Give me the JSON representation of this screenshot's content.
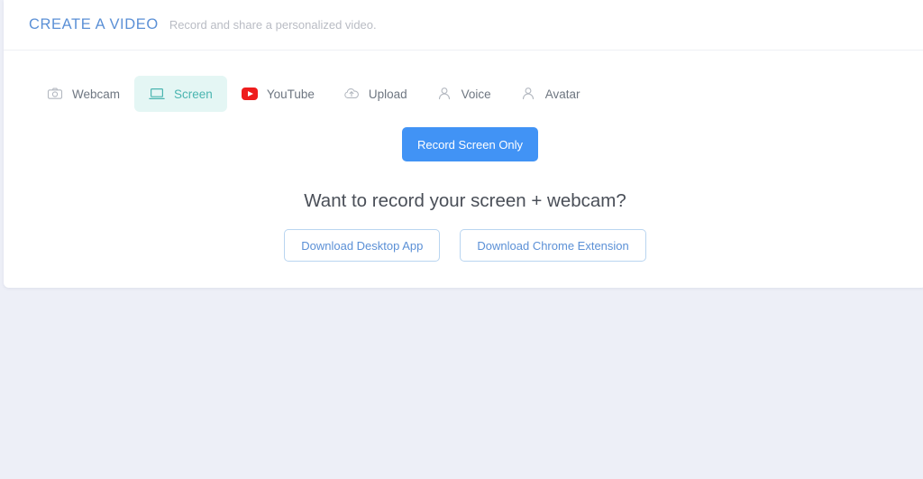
{
  "header": {
    "title": "CREATE A VIDEO",
    "subtitle": "Record and share a personalized video."
  },
  "tabs": [
    {
      "label": "Webcam",
      "icon": "camera-icon",
      "active": false
    },
    {
      "label": "Screen",
      "icon": "laptop-screen-icon",
      "active": true
    },
    {
      "label": "YouTube",
      "icon": "youtube-icon",
      "active": false
    },
    {
      "label": "Upload",
      "icon": "cloud-upload-icon",
      "active": false
    },
    {
      "label": "Voice",
      "icon": "person-icon",
      "active": false
    },
    {
      "label": "Avatar",
      "icon": "person-icon",
      "active": false
    }
  ],
  "main": {
    "record_button_label": "Record Screen Only",
    "prompt": "Want to record your screen + webcam?",
    "desktop_app_label": "Download Desktop App",
    "chrome_extension_label": "Download Chrome Extension"
  },
  "colors": {
    "accent_blue": "#4193f5",
    "title_blue": "#5b90d6",
    "active_tab_teal": "#4ab5b0",
    "active_tab_bg": "#e4f6f4",
    "youtube_red": "#ee1d1d",
    "page_bg": "#edeff7"
  }
}
